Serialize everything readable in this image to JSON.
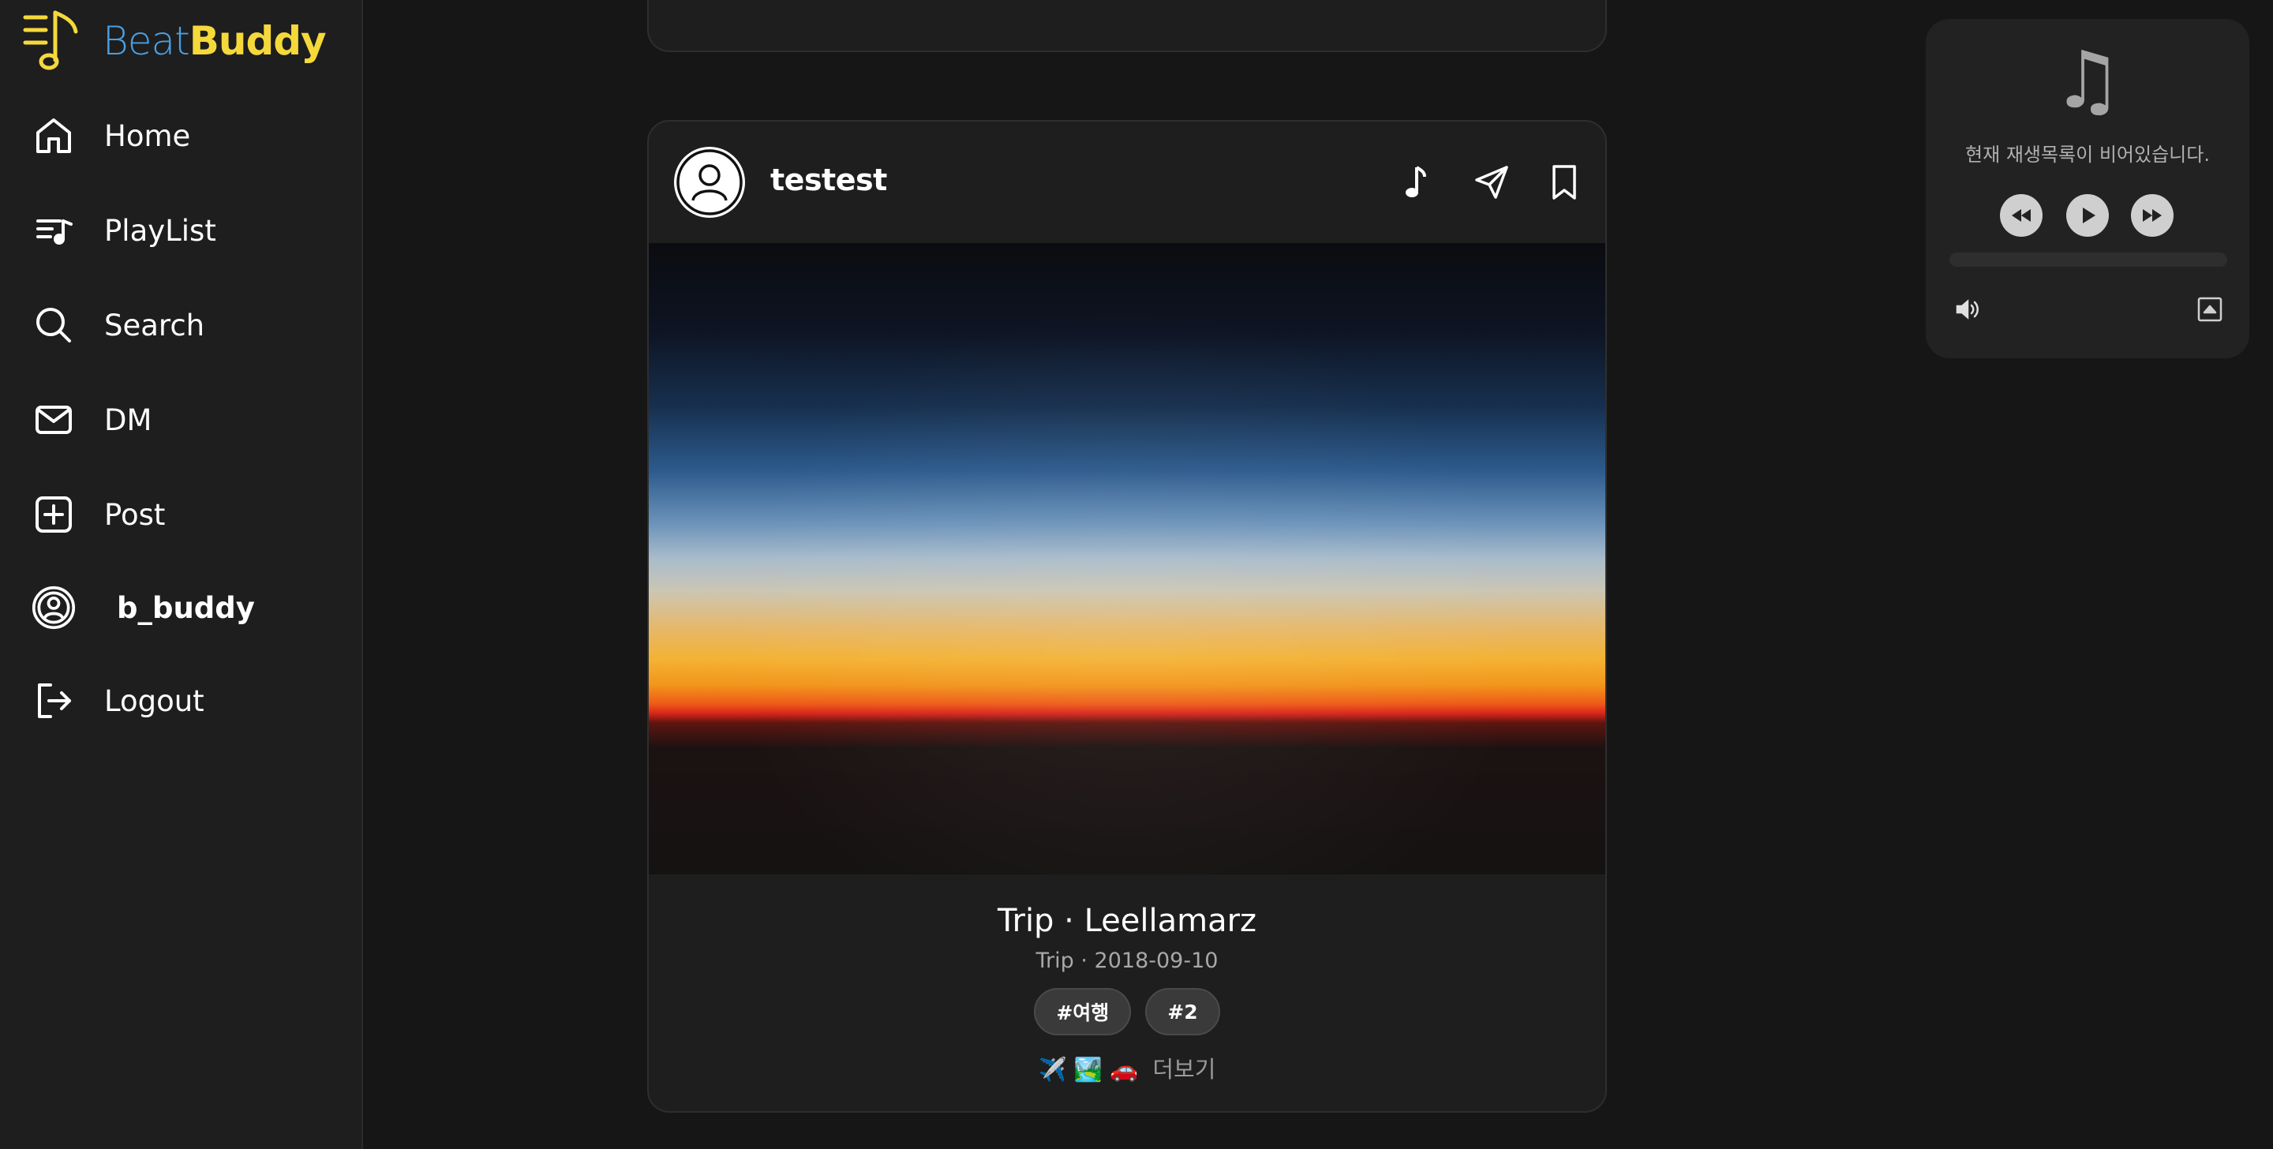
{
  "app": {
    "logo_beat": "Beat",
    "logo_buddy": "Buddy"
  },
  "sidebar": {
    "items": [
      {
        "label": "Home",
        "icon": "home-icon"
      },
      {
        "label": "PlayList",
        "icon": "playlist-icon"
      },
      {
        "label": "Search",
        "icon": "search-icon"
      },
      {
        "label": "DM",
        "icon": "mail-icon"
      },
      {
        "label": "Post",
        "icon": "plus-square-icon"
      },
      {
        "label": "b_buddy",
        "icon": "profile-icon"
      },
      {
        "label": "Logout",
        "icon": "logout-icon"
      }
    ]
  },
  "post": {
    "username": "testest",
    "title": "Trip · Leellamarz",
    "meta": "Trip · 2018-09-10",
    "tags": [
      "#여행",
      "#2"
    ],
    "caption_emoji": "✈️ 🏞️ 🚗",
    "more_label": "더보기",
    "actions": [
      "music-note-icon",
      "send-icon",
      "bookmark-icon"
    ]
  },
  "player": {
    "empty_message": "현재 재생목록이 비어있습니다.",
    "progress": 0,
    "controls": [
      "rewind-icon",
      "play-icon",
      "fast-forward-icon",
      "volume-icon",
      "minimize-icon"
    ]
  },
  "colors": {
    "background": "#161616",
    "sidebar": "#1e1e1e",
    "card": "#1e1e1e",
    "logo_blue": "#4a9fe3",
    "logo_yellow": "#f5d93b",
    "player": "#222222"
  }
}
